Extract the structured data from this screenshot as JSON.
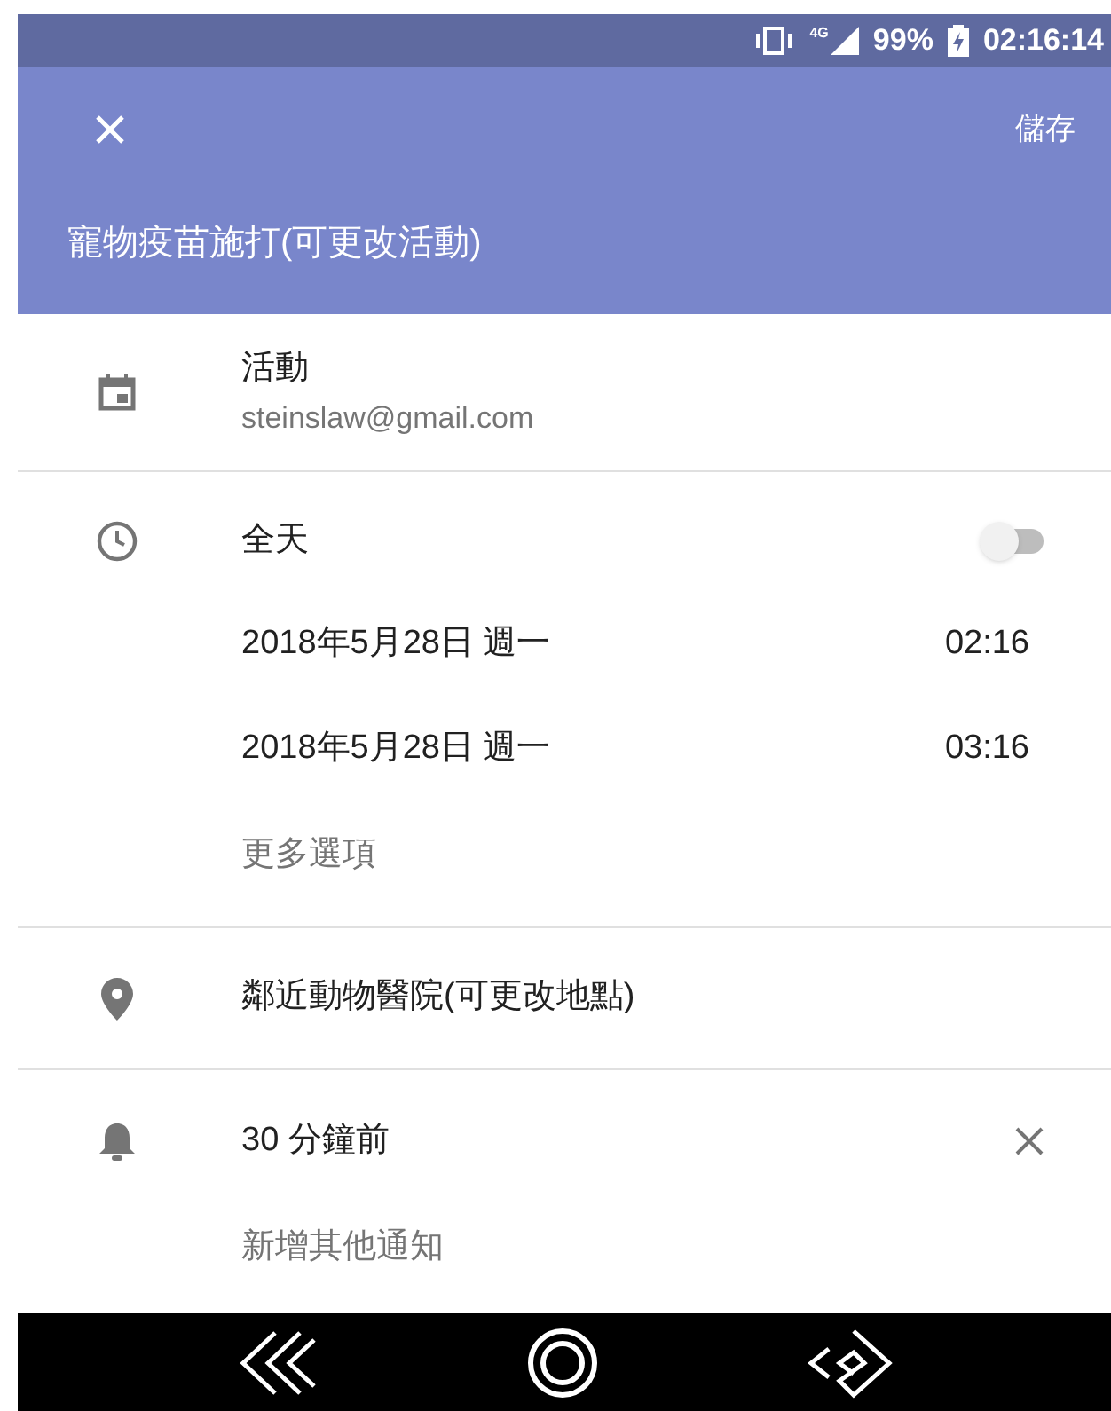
{
  "status_bar": {
    "network": "4G",
    "battery": "99%",
    "time": "02:16:14"
  },
  "toolbar": {
    "save": "儲存",
    "title": "寵物疫苗施打(可更改活動)"
  },
  "calendar": {
    "name": "活動",
    "account": "steinslaw@gmail.com"
  },
  "time": {
    "all_day": {
      "label": "全天",
      "on": false
    },
    "rows": [
      {
        "date": "2018年5月28日 週一",
        "time": "02:16"
      },
      {
        "date": "2018年5月28日 週一",
        "time": "03:16"
      }
    ],
    "more_options": "更多選項"
  },
  "location": "鄰近動物醫院(可更改地點)",
  "notifications": [
    {
      "label": "30 分鐘前"
    }
  ],
  "add_notification": "新增其他通知"
}
